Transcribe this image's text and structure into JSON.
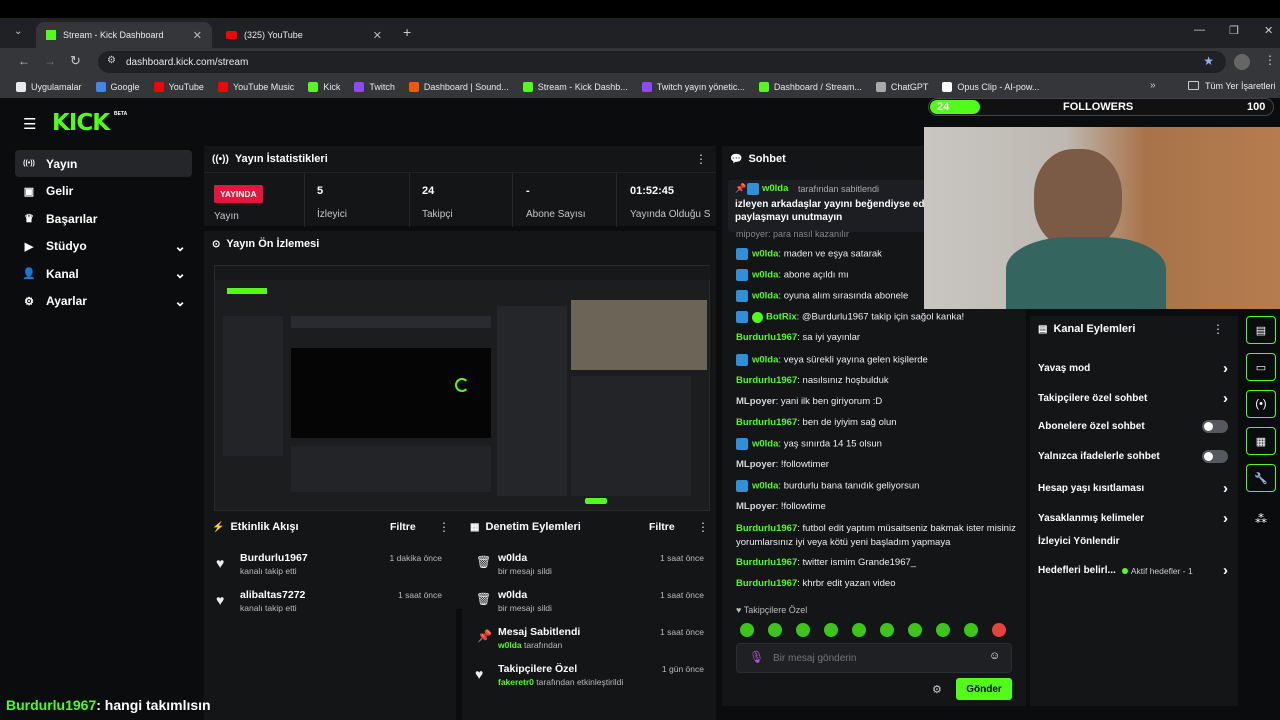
{
  "tabs": [
    {
      "title": "Stream - Kick Dashboard",
      "icon": "kick-icon"
    },
    {
      "title": "(325) YouTube",
      "icon": "youtube-icon"
    }
  ],
  "url": "dashboard.kick.com/stream",
  "bookmarks": [
    {
      "label": "Uygulamalar",
      "color": "#e8eaed"
    },
    {
      "label": "Google",
      "color": "#4285f4"
    },
    {
      "label": "YouTube",
      "color": "#ff0000"
    },
    {
      "label": "YouTube Music",
      "color": "#ff0000"
    },
    {
      "label": "Kick",
      "color": "#53fc18"
    },
    {
      "label": "Twitch",
      "color": "#9146ff"
    },
    {
      "label": "Dashboard | Sound...",
      "color": "#ff5500"
    },
    {
      "label": "Stream - Kick Dashb...",
      "color": "#53fc18"
    },
    {
      "label": "Twitch yayın yönetic...",
      "color": "#9146ff"
    },
    {
      "label": "Dashboard / Stream...",
      "color": "#53fc18"
    },
    {
      "label": "ChatGPT",
      "color": "#aaaaaa"
    },
    {
      "label": "Opus Clip - AI-pow...",
      "color": "#ffffff"
    }
  ],
  "bookmarks_all": "Tüm Yer İşaretleri",
  "overlay": {
    "left_count": "24",
    "label": "FOLLOWERS",
    "right_count": "100"
  },
  "brand": {
    "logo": "KICK",
    "beta": "BETA"
  },
  "nav": [
    {
      "label": "Yayın",
      "icon": "broadcast-icon",
      "chevron": false
    },
    {
      "label": "Gelir",
      "icon": "wallet-icon",
      "chevron": false
    },
    {
      "label": "Başarılar",
      "icon": "trophy-icon",
      "chevron": false
    },
    {
      "label": "Stüdyo",
      "icon": "studio-icon",
      "chevron": true
    },
    {
      "label": "Kanal",
      "icon": "channel-icon",
      "chevron": true
    },
    {
      "label": "Ayarlar",
      "icon": "gear-icon",
      "chevron": true
    }
  ],
  "stats": {
    "title": "Yayın İstatistikleri",
    "live_badge": "YAYINDA",
    "live_label": "Yayın",
    "items": [
      {
        "value": "5",
        "label": "İzleyici"
      },
      {
        "value": "24",
        "label": "Takipçi"
      },
      {
        "value": "-",
        "label": "Abone Sayısı"
      },
      {
        "value": "01:52:45",
        "label": "Yayında Olduğu Süre"
      }
    ]
  },
  "preview": {
    "title": "Yayın Ön İzlemesi"
  },
  "activity": {
    "title": "Etkinlik Akışı",
    "filter": "Filtre",
    "items": [
      {
        "name": "Burdurlu1967",
        "sub": "kanalı takip etti",
        "time": "1 dakika önce"
      },
      {
        "name": "alibaltas7272",
        "sub": "kanalı takip etti",
        "time": "1 saat önce"
      }
    ]
  },
  "moderation": {
    "title": "Denetim Eylemleri",
    "filter": "Filtre",
    "items": [
      {
        "name": "w0lda",
        "sub": "bir mesajı sildi",
        "time": "1 saat önce",
        "icon": "trash-icon"
      },
      {
        "name": "w0lda",
        "sub": "bir mesajı sildi",
        "time": "1 saat önce",
        "icon": "trash-icon"
      },
      {
        "name": "Mesaj Sabitlendi",
        "sub_user": "w0lda",
        "sub": "tarafından",
        "time": "1 saat önce",
        "icon": "pin-icon"
      },
      {
        "name": "Takipçilere Özel",
        "sub_user": "fakeretr0",
        "sub": "tarafından etkinleştirildi",
        "time": "1 gün önce",
        "icon": "heart-icon"
      }
    ]
  },
  "chat": {
    "title": "Sohbet",
    "pinned_by": "w0lda",
    "pinned_suffix": "tarafından sabitlendi",
    "pinned_text": "izleyen arkadaşlar yayını beğendiyse edip paylaşmayı unutmayın",
    "partial_line": "mipoyer: para nasıl kazanılır",
    "messages": [
      {
        "user": "w0lda",
        "text": "maden ve eşya satarak",
        "color": "#53fc18",
        "kick": true,
        "bot": false
      },
      {
        "user": "w0lda",
        "text": "abone açıldı mı",
        "color": "#53fc18",
        "kick": true,
        "bot": false
      },
      {
        "user": "w0lda",
        "text": "oyuna alım sırasında abonele",
        "color": "#53fc18",
        "kick": true,
        "bot": false
      },
      {
        "user": "BotRix",
        "text": "@Burdurlu1967 takip için sağol kanka!",
        "color": "#53fc18",
        "kick": true,
        "bot": true
      },
      {
        "user": "Burdurlu1967",
        "text": "sa iyi yayınlar",
        "color": "#53fc18",
        "kick": false,
        "bot": false
      },
      {
        "user": "w0lda",
        "text": "veya sürekli yayına gelen kişilerde",
        "color": "#53fc18",
        "kick": true,
        "bot": false
      },
      {
        "user": "Burdurlu1967",
        "text": "nasılsınız hoşbulduk",
        "color": "#53fc18",
        "kick": false,
        "bot": false
      },
      {
        "user": "MLpoyer",
        "text": "yani ilk ben giriyorum :D",
        "color": "#d6d6d6",
        "kick": false,
        "bot": false
      },
      {
        "user": "Burdurlu1967",
        "text": "ben de iyiyim sağ olun",
        "color": "#53fc18",
        "kick": false,
        "bot": false
      },
      {
        "user": "w0lda",
        "text": "yaş sınırda 14 15 olsun",
        "color": "#53fc18",
        "kick": true,
        "bot": false
      },
      {
        "user": "MLpoyer",
        "text": "!followtimer",
        "color": "#d6d6d6",
        "kick": false,
        "bot": false
      },
      {
        "user": "w0lda",
        "text": "burdurlu bana tanıdık geliyorsun",
        "color": "#53fc18",
        "kick": true,
        "bot": false
      },
      {
        "user": "MLpoyer",
        "text": "!followtime",
        "color": "#d6d6d6",
        "kick": false,
        "bot": false
      },
      {
        "user": "Burdurlu1967",
        "text": "futbol edit yaptım müsaitseniz bakmak ister misiniz yorumlarsınız iyi veya kötü yeni başladım yapmaya",
        "color": "#53fc18",
        "kick": false,
        "bot": false
      },
      {
        "user": "Burdurlu1967",
        "text": "twitter ismim Grande1967_",
        "color": "#53fc18",
        "kick": false,
        "bot": false
      },
      {
        "user": "Burdurlu1967",
        "text": "khrbr edit yazan video",
        "color": "#53fc18",
        "kick": false,
        "bot": false
      }
    ],
    "followers_only": "Takipçilere Özel",
    "placeholder": "Bir mesaj gönderin",
    "send": "Gönder"
  },
  "channel_actions": {
    "title": "Kanal Eylemleri",
    "items": [
      {
        "label": "Yavaş mod",
        "type": "chevron"
      },
      {
        "label": "Takipçilere özel sohbet",
        "type": "chevron"
      },
      {
        "label": "Abonelere özel sohbet",
        "type": "toggle"
      },
      {
        "label": "Yalnızca ifadelerle sohbet",
        "type": "toggle"
      },
      {
        "label": "Hesap yaşı kısıtlaması",
        "type": "chevron"
      },
      {
        "label": "Yasaklanmış kelimeler",
        "type": "chevron"
      },
      {
        "label": "İzleyici Yönlendir",
        "type": "none"
      },
      {
        "label": "Hedefleri belirl...",
        "type": "chevron",
        "extra": "Aktif hedefler - 1"
      }
    ]
  },
  "ticker": {
    "user": "Burdurlu1967",
    "text": ": hangi takımlısın"
  },
  "accent": "#53fc18",
  "live_color": "#e5163e"
}
